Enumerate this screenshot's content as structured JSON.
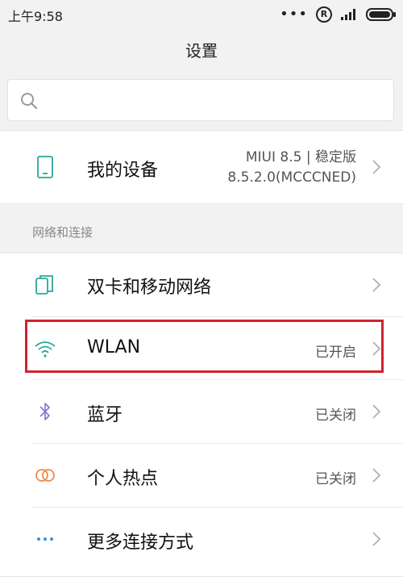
{
  "status_bar": {
    "time": "上午9:58",
    "dots": "•••",
    "registered_mark": "R"
  },
  "header": {
    "title": "设置"
  },
  "search": {
    "placeholder": ""
  },
  "my_device": {
    "label": "我的设备",
    "value_line1": "MIUI 8.5 | 稳定版",
    "value_line2": "8.5.2.0(MCCCNED)"
  },
  "section": {
    "title": "网络和连接"
  },
  "items": [
    {
      "label": "双卡和移动网络",
      "value": ""
    },
    {
      "label": "WLAN",
      "value": "已开启"
    },
    {
      "label": "蓝牙",
      "value": "已关闭"
    },
    {
      "label": "个人热点",
      "value": "已关闭"
    },
    {
      "label": "更多连接方式",
      "value": ""
    }
  ],
  "colors": {
    "icon_teal": "#2aa89a",
    "bluetooth_purple": "#8a6fd6",
    "hotspot_orange": "#f08a4b",
    "more_blue": "#3a8fd6",
    "highlight_red": "#d0232e"
  }
}
